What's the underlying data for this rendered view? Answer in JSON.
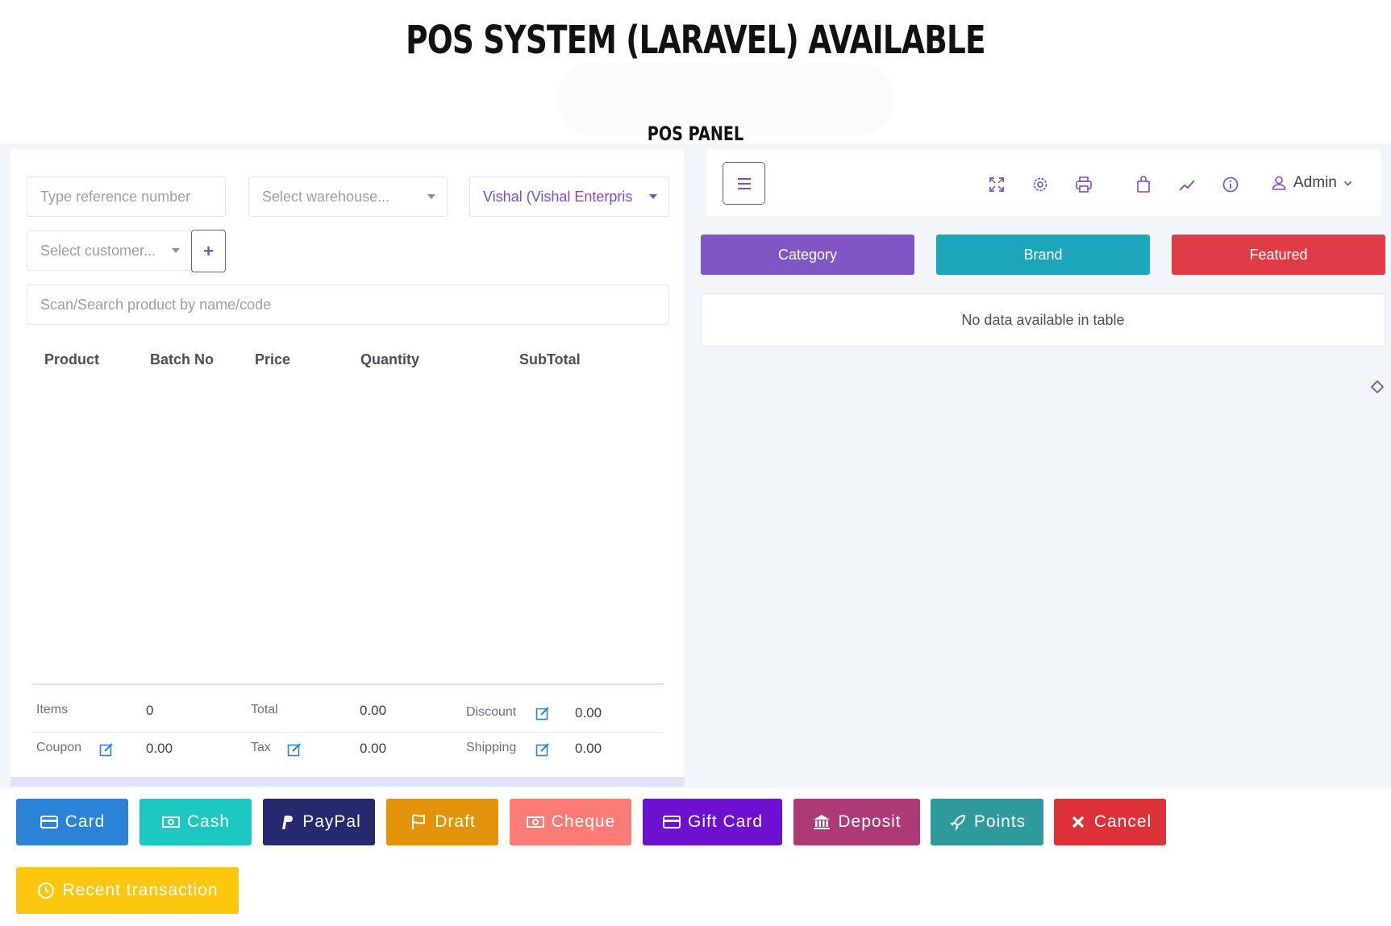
{
  "banner": {
    "title": "POS SYSTEM (LARAVEL) AVAILABLE",
    "subtitle": "POS PANEL"
  },
  "left": {
    "reference_placeholder": "Type reference number",
    "warehouse_placeholder": "Select warehouse...",
    "biller_value": "Vishal (Vishal Enterpris",
    "customer_placeholder": "Select customer...",
    "add_customer_label": "+",
    "search_placeholder": "Scan/Search product by name/code",
    "table_headers": [
      "Product",
      "Batch No",
      "Price",
      "Quantity",
      "SubTotal"
    ],
    "summary": {
      "items_label": "Items",
      "items_value": "0",
      "total_label": "Total",
      "total_value": "0.00",
      "discount_label": "Discount",
      "discount_value": "0.00",
      "coupon_label": "Coupon",
      "coupon_value": "0.00",
      "tax_label": "Tax",
      "tax_value": "0.00",
      "shipping_label": "Shipping",
      "shipping_value": "0.00"
    }
  },
  "right": {
    "topbar_icons": [
      "fullscreen-icon",
      "settings-icon",
      "print-icon",
      "shopping-bag-icon",
      "chart-icon",
      "info-icon",
      "user-icon"
    ],
    "admin_label": "Admin",
    "tabs": [
      {
        "label": "Category",
        "color": "#8056c4"
      },
      {
        "label": "Brand",
        "color": "#1ca5bb"
      },
      {
        "label": "Featured",
        "color": "#e03c48"
      }
    ],
    "empty_message": "No data available in table"
  },
  "payments": [
    {
      "label": "Card",
      "icon": "credit-card-icon",
      "color": "#2b83d8"
    },
    {
      "label": "Cash",
      "icon": "money-icon",
      "color": "#1ec8c2"
    },
    {
      "label": "PayPal",
      "icon": "paypal-icon",
      "color": "#27296e"
    },
    {
      "label": "Draft",
      "icon": "flag-icon",
      "color": "#e29309"
    },
    {
      "label": "Cheque",
      "icon": "money-icon",
      "color": "#fd7b77"
    },
    {
      "label": "Gift Card",
      "icon": "credit-card-icon",
      "color": "#6d10cf"
    },
    {
      "label": "Deposit",
      "icon": "bank-icon",
      "color": "#ad3a74"
    },
    {
      "label": "Points",
      "icon": "rocket-icon",
      "color": "#2f9a9b"
    },
    {
      "label": "Cancel",
      "icon": "close-icon",
      "color": "#dc3138"
    },
    {
      "label": "Recent transaction",
      "icon": "clock-icon",
      "color": "#fdc60f"
    }
  ]
}
